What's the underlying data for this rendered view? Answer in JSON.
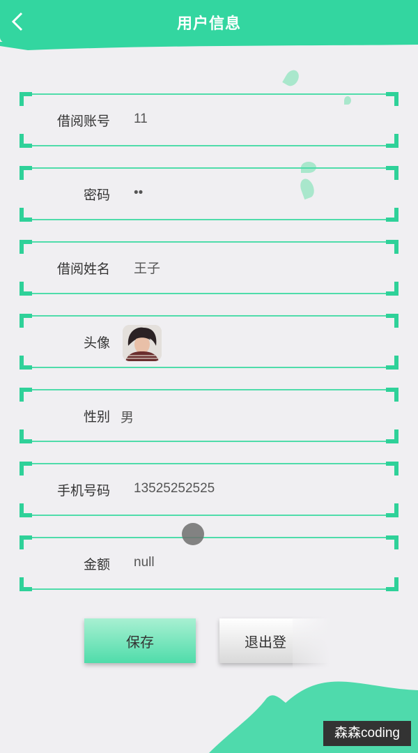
{
  "header": {
    "title": "用户信息",
    "back_icon": "chevron-left-icon"
  },
  "fields": [
    {
      "label": "借阅账号",
      "value": "11"
    },
    {
      "label": "密码",
      "value": "••"
    },
    {
      "label": "借阅姓名",
      "value": "王子"
    },
    {
      "label": "头像",
      "value": ""
    },
    {
      "label": "性别",
      "value": "男"
    },
    {
      "label": "手机号码",
      "value": "13525252525"
    },
    {
      "label": "金额",
      "value": "null"
    }
  ],
  "buttons": {
    "save": "保存",
    "logout": "退出登"
  },
  "watermark": "森森coding",
  "colors": {
    "accent": "#33d6a0",
    "border": "#4fdcaa",
    "background": "#f0eff2"
  }
}
